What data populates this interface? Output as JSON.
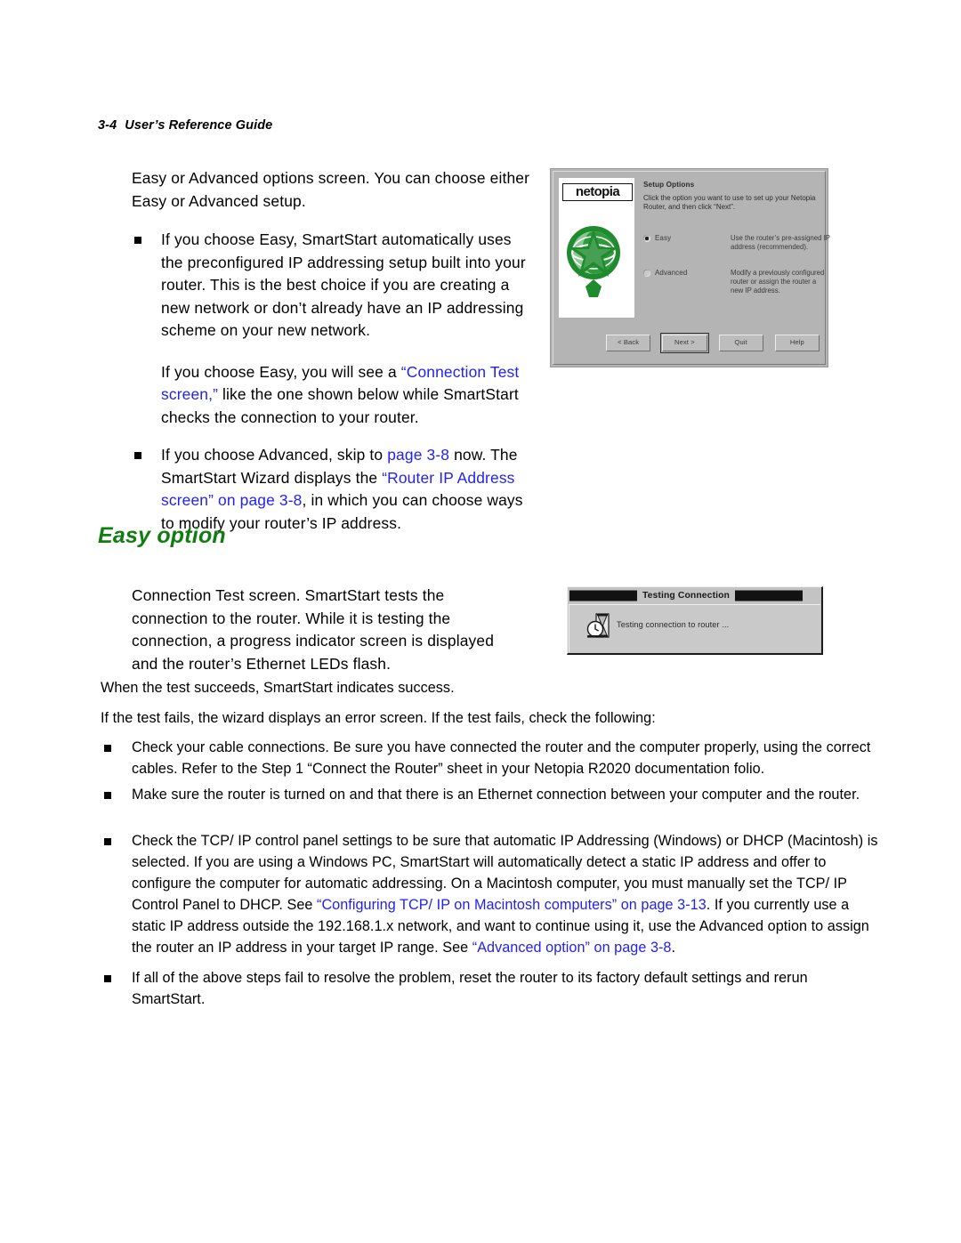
{
  "header": {
    "folio": "3-4",
    "title": "User’s Reference Guide"
  },
  "intro": {
    "lead": "Easy or Advanced options screen. You can choose either Easy or Advanced setup.",
    "bullet1": {
      "text": "If you choose Easy, SmartStart automatically uses the preconfigured IP addressing setup built into your router. This is the best choice if you are creating a new network or don’t already have an IP addressing scheme on your new network.",
      "sub_pre": "If you choose Easy, you will see a ",
      "sub_link": "“Connection Test screen,”",
      "sub_post": " like the one shown below while SmartStart checks the connection to your router."
    },
    "bullet2": {
      "pre": "If you choose Advanced, skip to ",
      "link1": "page 3-8",
      "mid": " now. The SmartStart Wizard displays the ",
      "link2": "“Router IP Address screen” on page 3-8",
      "post": ", in which you can choose ways to modify your router’s IP address."
    }
  },
  "section": {
    "heading": "Easy option",
    "heading_color": "#117d11",
    "paragraph": "Connection Test screen. SmartStart tests the connection to the router. While it is testing the connection, a progress indicator screen is displayed and the router’s Ethernet LEDs flash."
  },
  "body": {
    "succeeds": "When the test succeeds, SmartStart indicates success.",
    "fails": "If the test fails, the wizard displays an error screen. If the test fails, check the following:",
    "bullets": [
      {
        "text": "Check your cable connections. Be sure you have connected the router and the computer properly, using the correct cables. Refer to the Step 1 “Connect the Router” sheet in your Netopia R2020 documentation folio."
      },
      {
        "text": "Make sure the router is turned on and that there is an Ethernet connection between your computer and the router."
      },
      {
        "pre": "Check the TCP/ IP control panel settings to be sure that automatic IP Addressing (Windows) or DHCP (Macintosh) is selected. If you are using a Windows PC, SmartStart will automatically detect a static IP address and offer to configure the computer for automatic addressing. On a Macintosh computer, you must manually set the TCP/ IP Control Panel to DHCP. See ",
        "link1": "“Configuring TCP/ IP on Macintosh computers” on page 3-13",
        "mid": ". If you currently use a static IP address outside the 192.168.1.x network, and want to continue using it, use the Advanced option to assign the router an IP address in your target IP range. See ",
        "link2": "“Advanced option” on page 3-8",
        "post": "."
      },
      {
        "text": "If all of the above steps fail to resolve the problem, reset the router to its factory default settings and rerun SmartStart."
      }
    ]
  },
  "setup_dialog": {
    "logo_word": "netopia",
    "title": "Setup Options",
    "description": "Click the option you want to use to set up your Netopia Router, and then click “Next”.",
    "options": [
      {
        "label": "Easy",
        "description": "Use the router’s pre-assigned IP address (recommended).",
        "selected": true
      },
      {
        "label": "Advanced",
        "description": "Modify a previously configured router or assign the router a new IP address.",
        "selected": false
      }
    ],
    "buttons": [
      {
        "label": "< Back",
        "default": false
      },
      {
        "label": "Next >",
        "default": true
      },
      {
        "label": "Quit",
        "default": false
      },
      {
        "label": "Help",
        "default": false
      }
    ]
  },
  "test_dialog": {
    "title": "Testing Connection",
    "message": "Testing connection to router ..."
  }
}
